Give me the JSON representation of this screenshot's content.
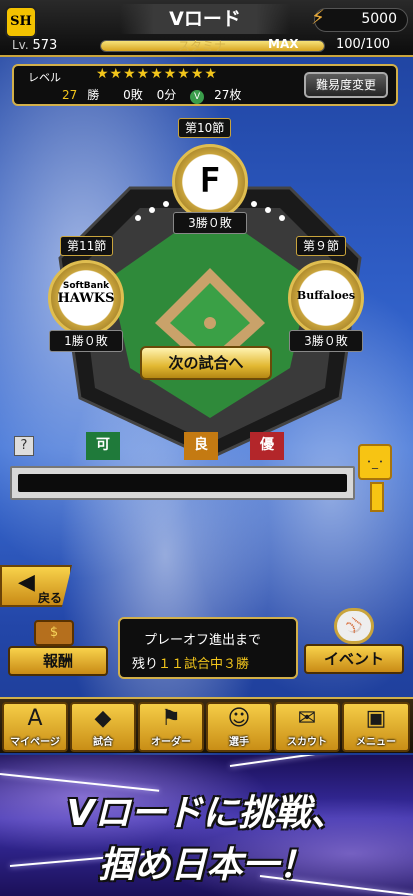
{
  "header": {
    "logo_text": "SH",
    "title": "Vロード",
    "coins": "5000",
    "level_label": "Lv.",
    "level": "573",
    "stamina_label": "スタミナ",
    "stamina_max": "MAX",
    "stamina_value": "100/100",
    "stamina_fraction": 1.0
  },
  "level_panel": {
    "label": "レベル",
    "stars": "★★★★★★★★★",
    "wins": "27",
    "wins_suffix": "勝",
    "losses": "0敗",
    "draws": "0分",
    "tickets": "27枚",
    "ticket_icon": "V",
    "difficulty_button": "難易度変更"
  },
  "rounds": {
    "current": {
      "label": "第10節",
      "team": "F",
      "record": "3勝０敗"
    },
    "left": {
      "label": "第11節",
      "team_line1": "SoftBank",
      "team_line2": "HAWKS",
      "record": "1勝０敗"
    },
    "right": {
      "label": "第９節",
      "team_line1": "Buffaloes",
      "record": "3勝０敗"
    }
  },
  "next_button": "次の試合へ",
  "progress": {
    "help": "?",
    "flags": [
      "可",
      "良",
      "優"
    ],
    "mascot_face": "･_･"
  },
  "back_button": "戻る",
  "reward": {
    "chest_icon": "$",
    "label": "報酬"
  },
  "playoff": {
    "line1": "プレーオフ進出まで",
    "line2_prefix": "残り",
    "line2_value": "１１試合中３勝"
  },
  "event": {
    "ball_icon": "⚾",
    "label": "イベント"
  },
  "nav": [
    {
      "icon": "A",
      "label": "マイページ"
    },
    {
      "icon": "◆",
      "label": "試合"
    },
    {
      "icon": "⚑",
      "label": "オーダー"
    },
    {
      "icon": "☺",
      "label": "選手"
    },
    {
      "icon": "✉",
      "label": "スカウト"
    },
    {
      "icon": "▣",
      "label": "メニュー"
    }
  ],
  "banner": {
    "line1": "Vロードに挑戦、",
    "line2": "掴め日本一！"
  },
  "colors": {
    "accent_gold": "#d2b04a",
    "star_yellow": "#f2c51b"
  }
}
